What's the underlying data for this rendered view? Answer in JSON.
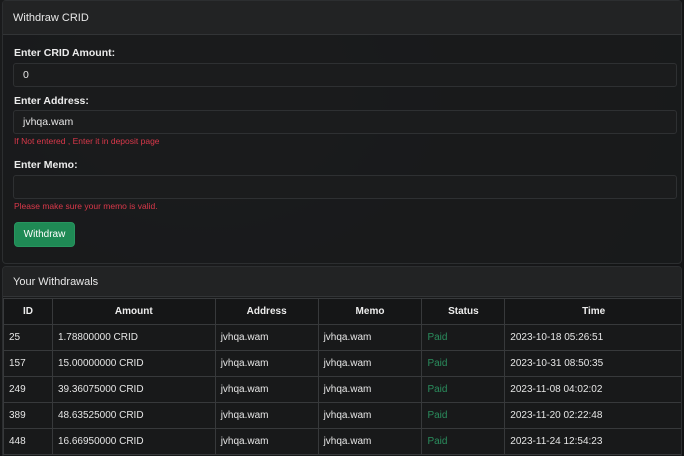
{
  "withdraw": {
    "title": "Withdraw CRID",
    "amount_label": "Enter CRID Amount:",
    "amount_value": "0",
    "address_label": "Enter Address:",
    "address_value": "jvhqa.wam",
    "address_hint": "If Not entered , Enter it in deposit page",
    "memo_label": "Enter Memo:",
    "memo_value": "",
    "memo_hint": "Please make sure your memo is valid.",
    "button_label": "Withdraw",
    "colors": {
      "button": "#1f8a55",
      "hint": "#d9384a"
    }
  },
  "history": {
    "title": "Your Withdrawals",
    "columns": [
      "ID",
      "Amount",
      "Address",
      "Memo",
      "Status",
      "Time"
    ],
    "rows": [
      {
        "id": "25",
        "amount": "1.78800000 CRID",
        "address": "jvhqa.wam",
        "memo": "jvhqa.wam",
        "status": "Paid",
        "time": "2023-10-18 05:26:51"
      },
      {
        "id": "157",
        "amount": "15.00000000 CRID",
        "address": "jvhqa.wam",
        "memo": "jvhqa.wam",
        "status": "Paid",
        "time": "2023-10-31 08:50:35"
      },
      {
        "id": "249",
        "amount": "39.36075000 CRID",
        "address": "jvhqa.wam",
        "memo": "jvhqa.wam",
        "status": "Paid",
        "time": "2023-11-08 04:02:02"
      },
      {
        "id": "389",
        "amount": "48.63525000 CRID",
        "address": "jvhqa.wam",
        "memo": "jvhqa.wam",
        "status": "Paid",
        "time": "2023-11-20 02:22:48"
      },
      {
        "id": "448",
        "amount": "16.66950000 CRID",
        "address": "jvhqa.wam",
        "memo": "jvhqa.wam",
        "status": "Paid",
        "time": "2023-11-24 12:54:23"
      }
    ],
    "colors": {
      "paid": "#2a8d5d"
    }
  }
}
